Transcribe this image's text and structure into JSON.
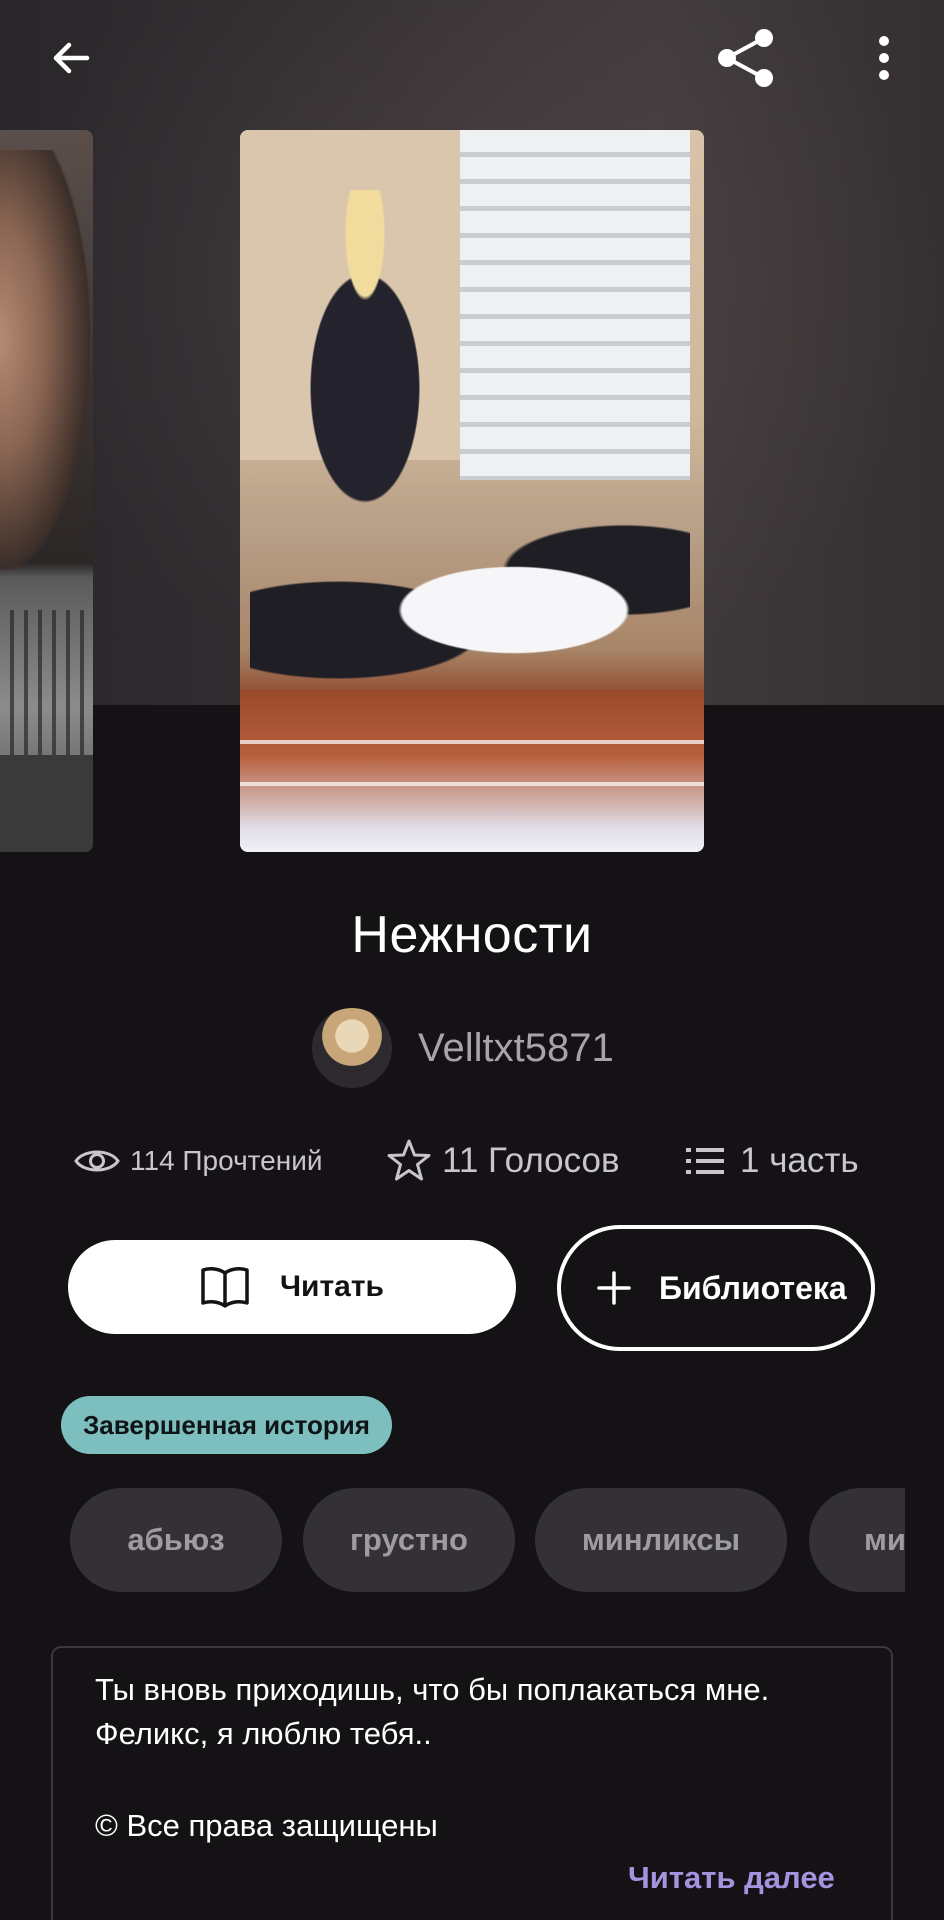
{
  "story": {
    "title": "Нежности",
    "author": "Velltxt5871",
    "stats": {
      "reads": "114 Прочтений",
      "votes": "11 Голосов",
      "parts": "1 часть"
    },
    "status_badge": "Завершенная история"
  },
  "actions": {
    "read_label": "Читать",
    "library_label": "Библиотека"
  },
  "tags": [
    "абьюз",
    "грустно",
    "минликсы",
    "ми"
  ],
  "description": {
    "line1": "Ты вновь приходишь, что бы поплакаться мне.",
    "line2": "Феликс, я люблю тебя..",
    "line3": "© Все права защищены",
    "read_more": "Читать далее"
  },
  "icons": {
    "back": "arrow-left-icon",
    "share": "share-icon",
    "more": "more-vertical-icon",
    "reads": "eye-icon",
    "votes": "star-icon",
    "parts": "list-icon",
    "read": "book-icon",
    "library": "plus-icon"
  },
  "colors": {
    "background": "#141215",
    "badge": "#7dbfbe",
    "read_more": "#a593e0",
    "tag_bg": "#333135"
  }
}
